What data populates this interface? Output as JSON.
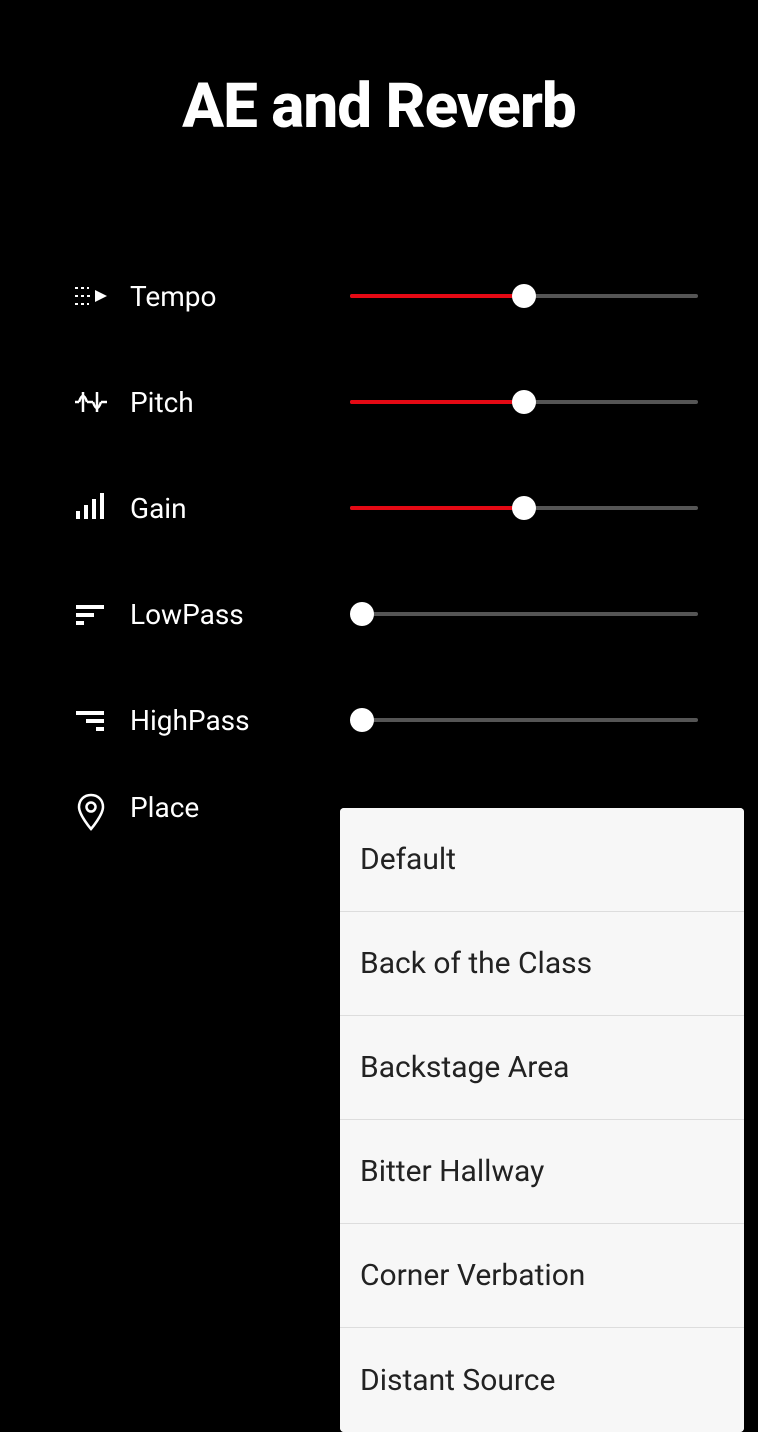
{
  "title": "AE and Reverb",
  "sliders": [
    {
      "key": "tempo",
      "label": "Tempo",
      "value": 0.5,
      "filled": true
    },
    {
      "key": "pitch",
      "label": "Pitch",
      "value": 0.5,
      "filled": true
    },
    {
      "key": "gain",
      "label": "Gain",
      "value": 0.5,
      "filled": true
    },
    {
      "key": "lowpass",
      "label": "LowPass",
      "value": 0.0,
      "filled": false
    },
    {
      "key": "highpass",
      "label": "HighPass",
      "value": 0.0,
      "filled": false
    }
  ],
  "place": {
    "label": "Place",
    "options": [
      "Default",
      "Back of the Class",
      "Backstage Area",
      "Bitter Hallway",
      "Corner Verbation",
      "Distant Source"
    ]
  },
  "colors": {
    "accent": "#e50914"
  }
}
